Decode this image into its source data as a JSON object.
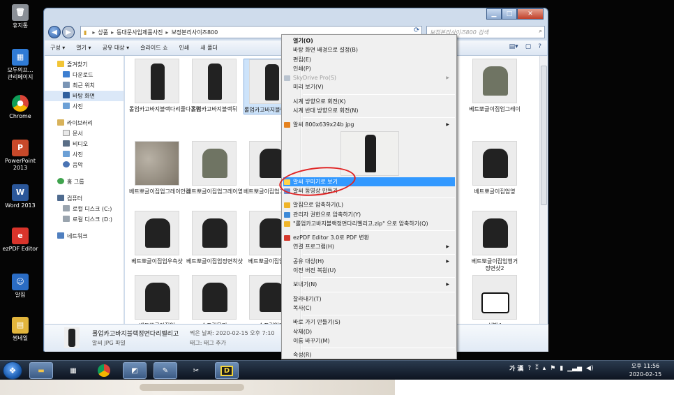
{
  "desktop_icons": [
    {
      "label": "휴지통",
      "icon": "recycle-bin-icon"
    },
    {
      "label": "모두의프...\n관리페이지",
      "icon": "web-app-icon"
    },
    {
      "label": "Chrome",
      "icon": "chrome-icon"
    },
    {
      "label": "PowerPoint\n2013",
      "icon": "powerpoint-icon"
    },
    {
      "label": "Word 2013",
      "icon": "word-icon"
    },
    {
      "label": "ezPDF Editor",
      "icon": "ezpdf-icon"
    },
    {
      "label": "알집",
      "icon": "alzip-icon"
    },
    {
      "label": "썸네일",
      "icon": "folder-icon"
    }
  ],
  "address": {
    "crumbs": [
      "상품",
      "동대문사입제품사진",
      "보정본리사이즈800"
    ],
    "search_placeholder": "보정본리사이즈800 검색"
  },
  "toolbar": [
    "구성 ▾",
    "열기 ▾",
    "공유 대상 ▾",
    "슬라이드 쇼",
    "인쇄",
    "새 폴더"
  ],
  "nav": {
    "favorites": "즐겨찾기",
    "fav_items": [
      "다운로드",
      "최근 위치",
      "바탕 화면",
      "사진"
    ],
    "libraries": "라이브러리",
    "lib_items": [
      "문서",
      "비디오",
      "사진",
      "음악"
    ],
    "homegroup": "홈 그룹",
    "computer": "컴퓨터",
    "computer_items": [
      "로컬 디스크 (C:)",
      "로컬 디스크 (D:)"
    ],
    "network": "네트워크"
  },
  "files": [
    "롤업카고바지블랙다리줄다홀림",
    "롤업카고바지블랙뒤",
    "롤업카고바지블랙정면다리벨리고",
    "베트뽀글이집업그레이",
    "베트뽀글이집업그레이안감",
    "베트뽀글이집업그레이옆",
    "베트뽀글이집업그레이앞",
    "베트뽀글이집업옆",
    "베트뽀글이집업우측샷",
    "베트뽀글이집업정면착샷",
    "베트뽀글이집업포켓",
    "베트뽀글이집업행거 정면샷2",
    "베트뽀글이집업",
    "슈프림뒷면",
    "슈프림앞면",
    "신발4"
  ],
  "details": {
    "name": "롤업카고바지블랙정면다리벨리고",
    "type": "알씨 JPG 파일",
    "date_label": "찍은 날짜:",
    "date_value": "2020-02-15 오후 7:10",
    "tag_label": "태그:",
    "tag_value": "태그 추가"
  },
  "menu": {
    "open": "열기(O)",
    "set_wallpaper": "바탕 화면 배경으로 설정(B)",
    "edit": "편집(E)",
    "print": "인쇄(P)",
    "skydrive": "SkyDrive Pro(S)",
    "preview": "미리 보기(V)",
    "rotate_cw": "시계 방향으로 회전(K)",
    "rotate_ccw": "시계 반대 방향으로 회전(N)",
    "alsee_info": "알씨 800x639x24b jpg",
    "alsee_decorate": "알씨 꾸미기로 보기",
    "alsee_video": "알씨 동영상 만들기",
    "zip_alzip": "알집으로 압축하기(L)",
    "zip_admin": "관리자 권한으로 압축하기(Y)",
    "zip_named": "\"롤업카고바지블랙정면다리벨리고.zip\" 으로 압축하기(Q)",
    "ezpdf": "ezPDF Editor 3.0로 PDF 변환",
    "open_with": "연결 프로그램(H)",
    "share_with": "공유 대상(H)",
    "restore_prev": "이전 버전 복원(U)",
    "send_to": "보내기(N)",
    "cut": "잘라내기(T)",
    "copy": "복사(C)",
    "create_shortcut": "바로 가기 만들기(S)",
    "delete": "삭제(D)",
    "rename": "이름 바꾸기(M)",
    "properties": "속성(R)"
  },
  "tray": {
    "ime": "가 漢",
    "time": "오후 11:56",
    "date": "2020-02-15"
  }
}
